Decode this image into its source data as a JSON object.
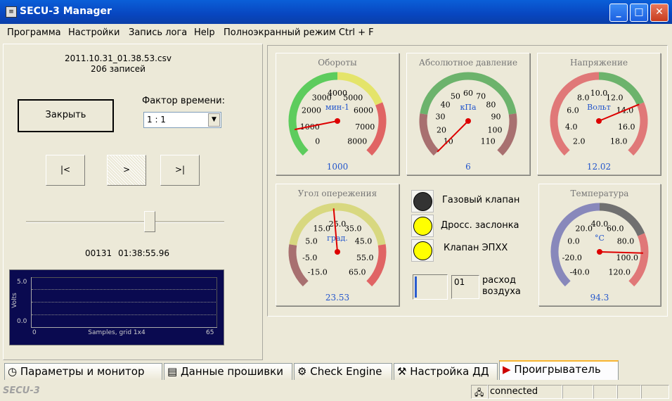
{
  "window": {
    "title": "SECU-3 Manager",
    "icon": "app-icon",
    "buttons": [
      "minimize",
      "maximize",
      "close"
    ]
  },
  "menu": [
    "Программа",
    "Настройки",
    "Запись лога",
    "Help",
    "Полноэкранный режим Ctrl + F"
  ],
  "player": {
    "filename": "2011.10.31_01.38.53.csv",
    "records": "206 записей",
    "close_label": "Закрыть",
    "time_factor_label": "Фактор времени:",
    "time_factor_value": "1 : 1",
    "nav": {
      "first": "|<",
      "play": ">",
      "last": ">|"
    },
    "slider_position": 0.62,
    "record_no": "00131",
    "record_time": "01:38:55.96"
  },
  "scope": {
    "y_max": "5.0",
    "y_min": "0.0",
    "ylabel": "Volts",
    "x_min": "0",
    "x_max": "65",
    "caption": "Samples, grid 1x4"
  },
  "gauges": [
    {
      "id": "rpm",
      "title": "Обороты",
      "unit": "мин-1",
      "value": "1000",
      "min": 0,
      "max": 8000,
      "ticks": [
        "0",
        "1000",
        "2000",
        "3000",
        "4000",
        "5000",
        "6000",
        "7000",
        "8000"
      ],
      "zones": [
        {
          "from": 0,
          "to": 0.5,
          "color": "#5dcc5d"
        },
        {
          "from": 0.5,
          "to": 0.75,
          "color": "#e4e46a"
        },
        {
          "from": 0.75,
          "to": 1,
          "color": "#e06464"
        }
      ],
      "needle": 1000
    },
    {
      "id": "map",
      "title": "Абсолютное давление",
      "unit": "кПа",
      "value": "6",
      "min": 10,
      "max": 110,
      "ticks": [
        "10",
        "20",
        "30",
        "40",
        "50",
        "60",
        "70",
        "80",
        "90",
        "100",
        "110"
      ],
      "zones": [
        {
          "from": 0,
          "to": 0.2,
          "color": "#a87070"
        },
        {
          "from": 0.2,
          "to": 0.8,
          "color": "#6cb36c"
        },
        {
          "from": 0.8,
          "to": 1,
          "color": "#a87070"
        }
      ],
      "needle": 10
    },
    {
      "id": "voltage",
      "title": "Напряжение",
      "unit": "Вольт",
      "value": "12.02",
      "min": 2,
      "max": 18,
      "ticks": [
        "2.0",
        "4.0",
        "6.0",
        "8.0",
        "10.0",
        "12.0",
        "14.0",
        "16.0",
        "18.0"
      ],
      "zones": [
        {
          "from": 0,
          "to": 0.5,
          "color": "#e07878"
        },
        {
          "from": 0.5,
          "to": 0.75,
          "color": "#6cb36c"
        },
        {
          "from": 0.75,
          "to": 1,
          "color": "#e07878"
        }
      ],
      "needle": 14
    },
    {
      "id": "advance",
      "title": "Угол опережения",
      "unit": "град.",
      "value": "23.53",
      "min": -15,
      "max": 65,
      "ticks": [
        "-15.0",
        "-5.0",
        "5.0",
        "15.0",
        "25.0",
        "35.0",
        "45.0",
        "55.0",
        "65.0"
      ],
      "zones": [
        {
          "from": 0,
          "to": 0.2,
          "color": "#a87070"
        },
        {
          "from": 0.2,
          "to": 0.8,
          "color": "#d8d880"
        },
        {
          "from": 0.8,
          "to": 1,
          "color": "#e06464"
        }
      ],
      "needle": 23.53
    },
    {
      "id": "temp",
      "title": "Температура",
      "unit": "°C",
      "value": "94.3",
      "min": -40,
      "max": 120,
      "ticks": [
        "-40.0",
        "-20.0",
        "0.0",
        "20.0",
        "40.0",
        "60.0",
        "80.0",
        "100.0",
        "120.0"
      ],
      "zones": [
        {
          "from": 0,
          "to": 0.5,
          "color": "#8888bb"
        },
        {
          "from": 0.5,
          "to": 0.75,
          "color": "#707070"
        },
        {
          "from": 0.75,
          "to": 1,
          "color": "#e07878"
        }
      ],
      "needle": 94.3
    }
  ],
  "indicators": [
    {
      "label": "Газовый клапан",
      "color": "#333333"
    },
    {
      "label": "Дросс. заслонка",
      "color": "#ffff00"
    },
    {
      "label": "Клапан ЭПХХ",
      "color": "#ffff00"
    }
  ],
  "airflow": {
    "value": "01",
    "label_line1": "расход",
    "label_line2": "воздуха"
  },
  "tabs": [
    {
      "label": "Параметры и монитор",
      "icon": "gauge-icon"
    },
    {
      "label": "Данные прошивки",
      "icon": "data-icon"
    },
    {
      "label": "Check Engine",
      "icon": "engine-icon"
    },
    {
      "label": "Настройка ДД",
      "icon": "wrench-icon"
    },
    {
      "label": "Проигрыватель",
      "icon": "play-icon",
      "active": true
    }
  ],
  "status": {
    "app_name": "SECU-3",
    "connection": "connected"
  }
}
